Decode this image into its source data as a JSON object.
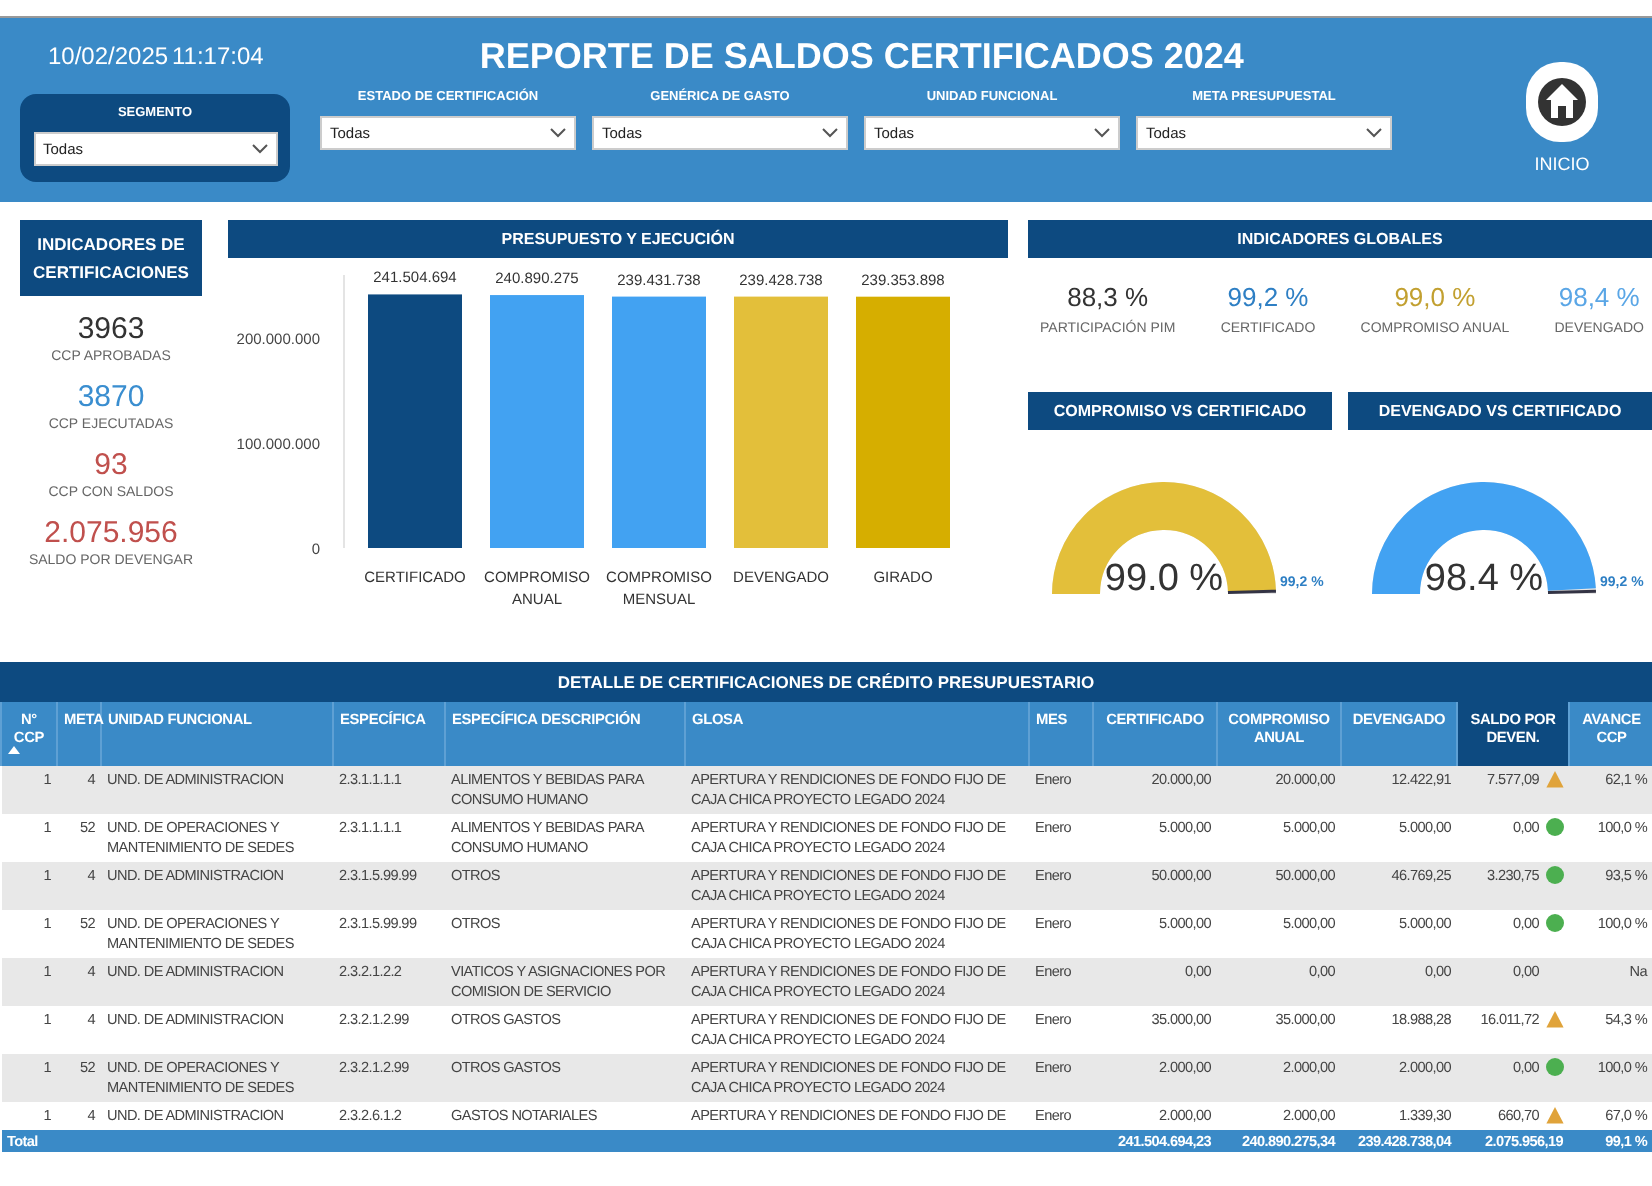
{
  "header": {
    "date": "10/02/2025",
    "time": "11:17:04",
    "title": "REPORTE DE SALDOS CERTIFICADOS 2024",
    "filters": [
      {
        "kind": "boxed",
        "label": "SEGMENTO",
        "value": "Todas"
      },
      {
        "kind": "plain",
        "label": "ESTADO DE CERTIFICACIÓN",
        "value": "Todas"
      },
      {
        "kind": "plain",
        "label": "GENÉRICA DE GASTO",
        "value": "Todas"
      },
      {
        "kind": "plain",
        "label": "UNIDAD FUNCIONAL",
        "value": "Todas"
      },
      {
        "kind": "plain",
        "label": "META PRESUPUESTAL",
        "value": "Todas"
      }
    ],
    "home_label": "INICIO"
  },
  "certification_indicators": {
    "title": "INDICADORES DE CERTIFICACIONES",
    "items": [
      {
        "value": "3963",
        "label": "CCP APROBADAS",
        "color": "#333333"
      },
      {
        "value": "3870",
        "label": "CCP EJECUTADAS",
        "color": "#3a8ed0"
      },
      {
        "value": "93",
        "label": "CCP CON SALDOS",
        "color": "#c0504d"
      },
      {
        "value": "2.075.956",
        "label": "SALDO POR DEVENGAR",
        "color": "#c0504d"
      }
    ]
  },
  "budget": {
    "title": "PRESUPUESTO Y EJECUCIÓN",
    "chart_data": {
      "type": "bar",
      "categories": [
        "CERTIFICADO",
        "COMPROMISO ANUAL",
        "COMPROMISO MENSUAL",
        "DEVENGADO",
        "GIRADO"
      ],
      "values": [
        241504694,
        240890275,
        239431738,
        239428738,
        239353898
      ],
      "value_labels": [
        "241.504.694",
        "240.890.275",
        "239.431.738",
        "239.428.738",
        "239.353.898"
      ],
      "ylim": [
        0,
        260000000
      ],
      "yticks": [
        {
          "value": 0,
          "label": "0"
        },
        {
          "value": 100000000,
          "label": "100.000.000"
        },
        {
          "value": 200000000,
          "label": "200.000.000"
        }
      ]
    }
  },
  "global_indicators": {
    "title": "INDICADORES GLOBALES",
    "items": [
      {
        "value": "88,3 %",
        "label": "PARTICIPACIÓN PIM",
        "color": "#333333"
      },
      {
        "value": "99,2 %",
        "label": "CERTIFICADO",
        "color": "#2e7fc4"
      },
      {
        "value": "99,0 %",
        "label": "COMPROMISO ANUAL",
        "color": "#c2a030"
      },
      {
        "value": "98,4 %",
        "label": "DEVENGADO",
        "color": "#5aa6e6"
      }
    ]
  },
  "gauges": [
    {
      "title": "COMPROMISO VS CERTIFICADO",
      "value": "99.0 %",
      "level": 0.99,
      "target": "99,2 %",
      "color": "#e3bf3a"
    },
    {
      "title": "DEVENGADO VS CERTIFICADO",
      "value": "98.4 %",
      "level": 0.984,
      "target": "99,2 %",
      "color": "#42a2f2"
    }
  ],
  "table": {
    "title": "DETALLE DE CERTIFICACIONES DE CRÉDITO PRESUPUESTARIO",
    "columns": [
      {
        "label": "N° CCP",
        "sorted": true,
        "highlighted": false
      },
      {
        "label": "META",
        "sorted": false,
        "highlighted": false
      },
      {
        "label": "UNIDAD FUNCIONAL",
        "sorted": false,
        "highlighted": false
      },
      {
        "label": "ESPECÍFICA",
        "sorted": false,
        "highlighted": false
      },
      {
        "label": "ESPECÍFICA DESCRIPCIÓN",
        "sorted": false,
        "highlighted": false
      },
      {
        "label": "GLOSA",
        "sorted": false,
        "highlighted": false
      },
      {
        "label": "MES",
        "sorted": false,
        "highlighted": false
      },
      {
        "label": "CERTIFICADO",
        "sorted": false,
        "highlighted": false
      },
      {
        "label": "COMPROMISO ANUAL",
        "sorted": false,
        "highlighted": false
      },
      {
        "label": "DEVENGADO",
        "sorted": false,
        "highlighted": false
      },
      {
        "label": "SALDO POR DEVEN.",
        "sorted": false,
        "highlighted": true
      },
      {
        "label": "AVANCE CCP",
        "sorted": false,
        "highlighted": false
      }
    ],
    "rows": [
      {
        "cells": [
          "1",
          "4",
          "UND. DE ADMINISTRACION",
          "2.3.1.1.1.1",
          "ALIMENTOS Y BEBIDAS PARA CONSUMO HUMANO",
          "APERTURA Y RENDICIONES DE FONDO FIJO DE CAJA CHICA PROYECTO LEGADO 2024",
          "Enero",
          "20.000,00",
          "20.000,00",
          "12.422,91",
          "7.577,09",
          "62,1 %"
        ],
        "kind": "warning"
      },
      {
        "cells": [
          "1",
          "52",
          "UND. DE OPERACIONES Y MANTENIMIENTO DE SEDES",
          "2.3.1.1.1.1",
          "ALIMENTOS Y BEBIDAS PARA CONSUMO HUMANO",
          "APERTURA Y RENDICIONES DE FONDO FIJO DE CAJA CHICA PROYECTO LEGADO 2024",
          "Enero",
          "5.000,00",
          "5.000,00",
          "5.000,00",
          "0,00",
          "100,0 %"
        ],
        "kind": "ok"
      },
      {
        "cells": [
          "1",
          "4",
          "UND. DE ADMINISTRACION",
          "2.3.1.5.99.99",
          "OTROS",
          "APERTURA Y RENDICIONES DE FONDO FIJO DE CAJA CHICA PROYECTO LEGADO 2024",
          "Enero",
          "50.000,00",
          "50.000,00",
          "46.769,25",
          "3.230,75",
          "93,5 %"
        ],
        "kind": "ok"
      },
      {
        "cells": [
          "1",
          "52",
          "UND. DE OPERACIONES Y MANTENIMIENTO DE SEDES",
          "2.3.1.5.99.99",
          "OTROS",
          "APERTURA Y RENDICIONES DE FONDO FIJO DE CAJA CHICA PROYECTO LEGADO 2024",
          "Enero",
          "5.000,00",
          "5.000,00",
          "5.000,00",
          "0,00",
          "100,0 %"
        ],
        "kind": "ok"
      },
      {
        "cells": [
          "1",
          "4",
          "UND. DE ADMINISTRACION",
          "2.3.2.1.2.2",
          "VIATICOS Y ASIGNACIONES POR COMISION DE SERVICIO",
          "APERTURA Y RENDICIONES DE FONDO FIJO DE CAJA CHICA PROYECTO LEGADO 2024",
          "Enero",
          "0,00",
          "0,00",
          "0,00",
          "0,00",
          "Na"
        ],
        "kind": "plain"
      },
      {
        "cells": [
          "1",
          "4",
          "UND. DE ADMINISTRACION",
          "2.3.2.1.2.99",
          "OTROS GASTOS",
          "APERTURA Y RENDICIONES DE FONDO FIJO DE CAJA CHICA PROYECTO LEGADO 2024",
          "Enero",
          "35.000,00",
          "35.000,00",
          "18.988,28",
          "16.011,72",
          "54,3 %"
        ],
        "kind": "warning"
      },
      {
        "cells": [
          "1",
          "52",
          "UND. DE OPERACIONES Y MANTENIMIENTO DE SEDES",
          "2.3.2.1.2.99",
          "OTROS GASTOS",
          "APERTURA Y RENDICIONES DE FONDO FIJO DE CAJA CHICA PROYECTO LEGADO 2024",
          "Enero",
          "2.000,00",
          "2.000,00",
          "2.000,00",
          "0,00",
          "100,0 %"
        ],
        "kind": "ok"
      },
      {
        "cells": [
          "1",
          "4",
          "UND. DE ADMINISTRACION",
          "2.3.2.6.1.2",
          "GASTOS NOTARIALES",
          "APERTURA Y RENDICIONES DE FONDO FIJO DE",
          "Enero",
          "2.000,00",
          "2.000,00",
          "1.339,30",
          "660,70",
          "67,0 %"
        ],
        "kind": "warning"
      }
    ],
    "total": {
      "label": "Total",
      "values": [
        "241.504.694,23",
        "240.890.275,34",
        "239.428.738,04",
        "2.075.956,19",
        "99,1 %"
      ]
    }
  }
}
